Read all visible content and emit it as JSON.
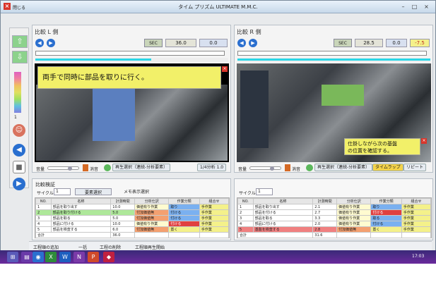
{
  "app": {
    "title": "タイム プリズム ULTIMATE M.M.C.",
    "close_label": "閉じる"
  },
  "left_panel": {
    "title": "比較 L 側",
    "sec_label": "SEC",
    "time_value": "36.0",
    "diff_value": "0.0",
    "banner_text": "両手で同時に部品を取りに行く。",
    "volume_label": "音量",
    "mute_label": "消音",
    "playmode_label": "再生選択（連続-分析要素）",
    "analysis_label": "1/4分析 1.0"
  },
  "right_panel": {
    "title": "比較 R 側",
    "sec_label": "SEC",
    "time_value": "28.5",
    "diff_value": "0.0",
    "delta_value": "-7.5",
    "banner_line1": "仕掛しながら次の基盤",
    "banner_line2": "の位置を確認する。",
    "volume_label": "音量",
    "mute_label": "消音",
    "playmode_label": "再生選択（連続-分析要素）",
    "timelapse_label": "タイムラップ",
    "repeat_label": "リピート"
  },
  "verify": {
    "title": "比較検証",
    "cycle_label": "サイクル",
    "cycle_value": "1",
    "bar_select_label": "要素選択",
    "memo_label": "メモ表示選択",
    "left_columns": [
      "NO.",
      "名称",
      "計測時間",
      "分析仕訳",
      "作業分類",
      "組合せ"
    ],
    "right_columns": [
      "NO.",
      "名称",
      "計測時間",
      "分析仕訳",
      "作業分類",
      "組合せ"
    ],
    "left_rows": [
      {
        "no": "1",
        "name": "部品を取り出す",
        "time": "10.0",
        "a": "価値有り作業",
        "b": "取り",
        "c": "手作業"
      },
      {
        "no": "2",
        "name": "部品を取り付ける",
        "time": "5.0",
        "a": "付加価値無",
        "b": "付ける",
        "c": "手作業"
      },
      {
        "no": "3",
        "name": "部品を取る",
        "time": "5.0",
        "a": "付加価値無",
        "b": "付ける",
        "c": "手作業"
      },
      {
        "no": "4",
        "name": "部品に付ける",
        "time": "10.0",
        "a": "価値有り作業",
        "b": "付ける",
        "c": "手作業"
      },
      {
        "no": "5",
        "name": "部品を検査する",
        "time": "6.0",
        "a": "付加価値無",
        "b": "置く",
        "c": "手作業"
      }
    ],
    "right_rows": [
      {
        "no": "1",
        "name": "部品を取り出す",
        "time": "2.1",
        "a": "価値有り作業",
        "b": "取り",
        "c": "手作業"
      },
      {
        "no": "2",
        "name": "部品を付ける",
        "time": "2.7",
        "a": "価値有り作業",
        "b": "付ける",
        "c": "手作業"
      },
      {
        "no": "3",
        "name": "部品を取る",
        "time": "3.3",
        "a": "価値有り作業",
        "b": "取る",
        "c": "手作業"
      },
      {
        "no": "4",
        "name": "部品に付ける",
        "time": "2.0",
        "a": "価値有り作業",
        "b": "付ける",
        "c": "手作業"
      },
      {
        "no": "5",
        "name": "基盤を検査する",
        "time": "2.8",
        "a": "付加価値無",
        "b": "置く",
        "c": "手作業"
      }
    ],
    "left_total_label": "合計",
    "left_total_value": "36.0",
    "right_total_label": "合計",
    "right_total_value": "31.6"
  },
  "footer": {
    "items": [
      "工程順の追加",
      "一括",
      "工程の削除",
      "工程順再生開始"
    ]
  },
  "taskbar": {
    "clock": "17:03"
  },
  "colors": {
    "accent_blue": "#2a6fcf",
    "banner_yellow": "#f2f069",
    "delta_yellow": "#f4f18a",
    "row_green": "#aee89a",
    "row_red": "#f08080"
  }
}
